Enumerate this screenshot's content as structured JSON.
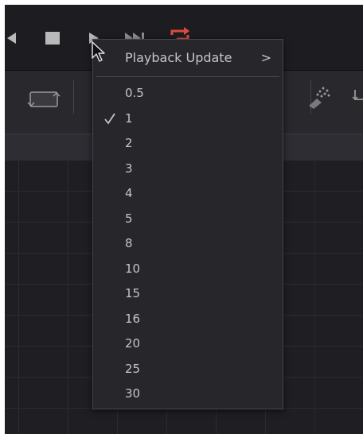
{
  "playback_menu": {
    "title": "Playback Update",
    "submenu_indicator": ">",
    "selected": "1",
    "items": [
      "0.5",
      "1",
      "2",
      "3",
      "4",
      "5",
      "8",
      "10",
      "15",
      "16",
      "20",
      "25",
      "30"
    ]
  },
  "transport": {
    "icons": [
      "previous-icon",
      "stop-icon",
      "play-icon",
      "next-icon",
      "loop-icon"
    ],
    "loop_color": "#e04a3c"
  },
  "toolbar": {
    "icons": [
      "transform-rect-icon",
      "particles-icon",
      "arrow-icon"
    ]
  },
  "colors": {
    "background": "#1f1f23",
    "menu_bg": "#26262b",
    "menu_text": "#c6c6c6",
    "accent_red": "#e04a3c"
  }
}
